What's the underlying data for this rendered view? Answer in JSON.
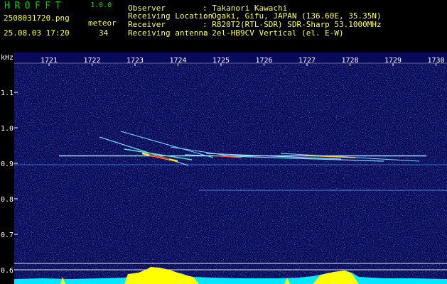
{
  "app": {
    "title": "HROFFT",
    "version": "1.0.0"
  },
  "capture": {
    "file": "2508031720.png",
    "timestamp": "25.08.03 17:20",
    "meteor_label": "meteor",
    "meteor_count": "34"
  },
  "station": [
    {
      "label": "Observer",
      "value": ": Takanori Kawachi"
    },
    {
      "label": "Receiving Location",
      "value": ": Ogaki, Gifu, JAPAN (136.60E, 35.35N)"
    },
    {
      "label": "Receiver",
      "value": ": R820T2(RTL-SDR) SDR-Sharp 53.1000MHz"
    },
    {
      "label": "Receiving antenna",
      "value": ": 2el-HB9CV Vertical (el. E-W)"
    }
  ],
  "plot": {
    "freq_unit": "kHz",
    "time_ticks": [
      "1721",
      "1722",
      "1723",
      "1724",
      "1725",
      "1726",
      "1727",
      "1728",
      "1729",
      "1730"
    ],
    "freq_ticks": [
      "1.1",
      "1.0",
      "0.9",
      "0.8",
      "0.7",
      "0.6"
    ],
    "colors": {
      "background": "#0a0a5a",
      "grid": "#ffffff",
      "label": "#ffffff",
      "meteor": "#ff3030",
      "carrier": "#90e8ff",
      "level_low": "#00ffff",
      "level_high": "#ffff00"
    }
  }
}
